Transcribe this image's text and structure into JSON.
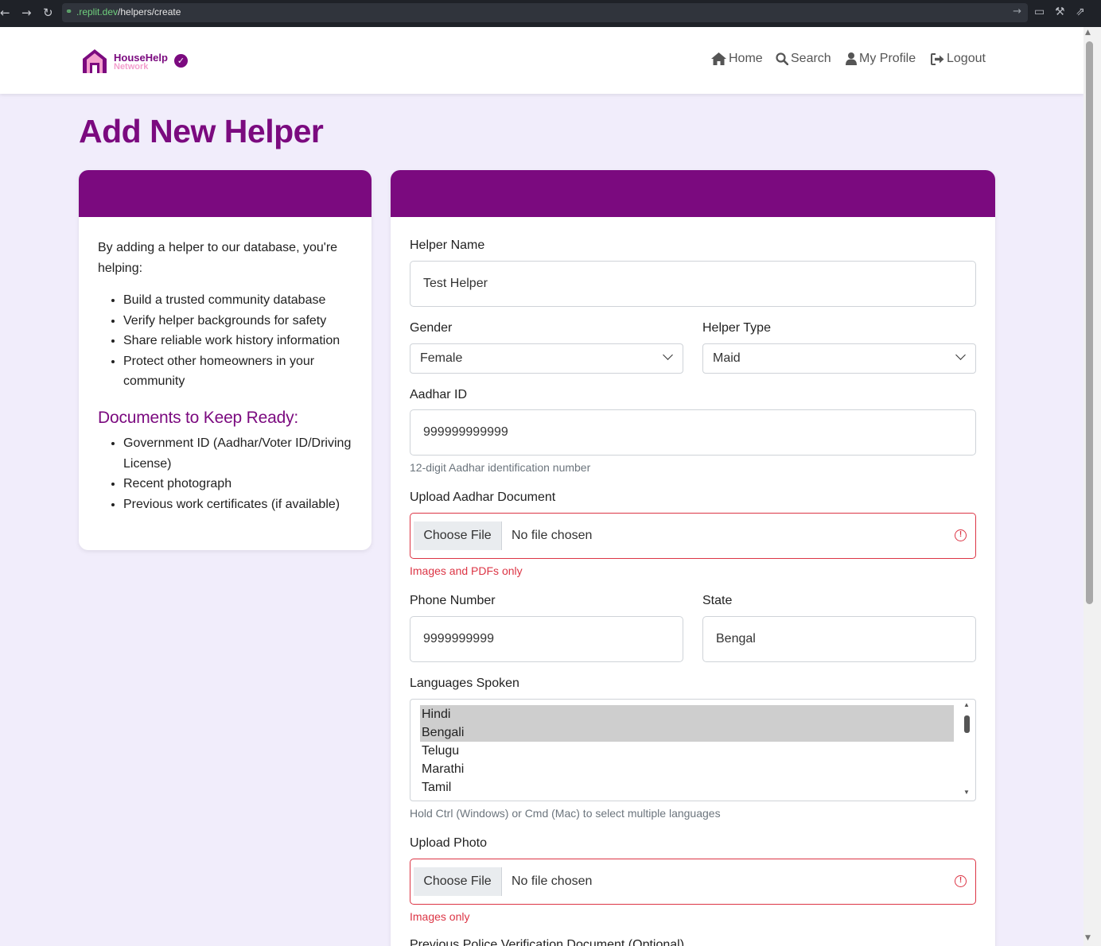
{
  "browser": {
    "url_host": ".replit.dev",
    "url_path": "/helpers/create"
  },
  "brand": {
    "name_line1": "HouseHelp",
    "name_line2": "Network",
    "primary_color": "#7b0a7f",
    "accent_color": "#f39fcd"
  },
  "nav": {
    "home": "Home",
    "search": "Search",
    "profile": "My Profile",
    "logout": "Logout"
  },
  "page": {
    "title": "Add New Helper"
  },
  "info": {
    "intro": "By adding a helper to our database, you're helping:",
    "benefits": [
      "Build a trusted community database",
      "Verify helper backgrounds for safety",
      "Share reliable work history information",
      "Protect other homeowners in your community"
    ],
    "docs_heading": "Documents to Keep Ready:",
    "docs": [
      "Government ID (Aadhar/Voter ID/Driving License)",
      "Recent photograph",
      "Previous work certificates (if available)"
    ]
  },
  "form": {
    "helper_name": {
      "label": "Helper Name",
      "value": "Test Helper"
    },
    "gender": {
      "label": "Gender",
      "value": "Female"
    },
    "helper_type": {
      "label": "Helper Type",
      "value": "Maid"
    },
    "aadhar_id": {
      "label": "Aadhar ID",
      "value": "999999999999",
      "help": "12-digit Aadhar identification number"
    },
    "aadhar_doc": {
      "label": "Upload Aadhar Document",
      "button": "Choose File",
      "status": "No file chosen",
      "error": "Images and PDFs only"
    },
    "phone": {
      "label": "Phone Number",
      "value": "9999999999"
    },
    "state": {
      "label": "State",
      "value": "Bengal"
    },
    "languages": {
      "label": "Languages Spoken",
      "options": [
        "Hindi",
        "Bengali",
        "Telugu",
        "Marathi",
        "Tamil"
      ],
      "selected": [
        "Hindi",
        "Bengali"
      ],
      "help": "Hold Ctrl (Windows) or Cmd (Mac) to select multiple languages"
    },
    "photo": {
      "label": "Upload Photo",
      "button": "Choose File",
      "status": "No file chosen",
      "error": "Images only"
    },
    "police_doc": {
      "label": "Previous Police Verification Document (Optional)"
    }
  }
}
